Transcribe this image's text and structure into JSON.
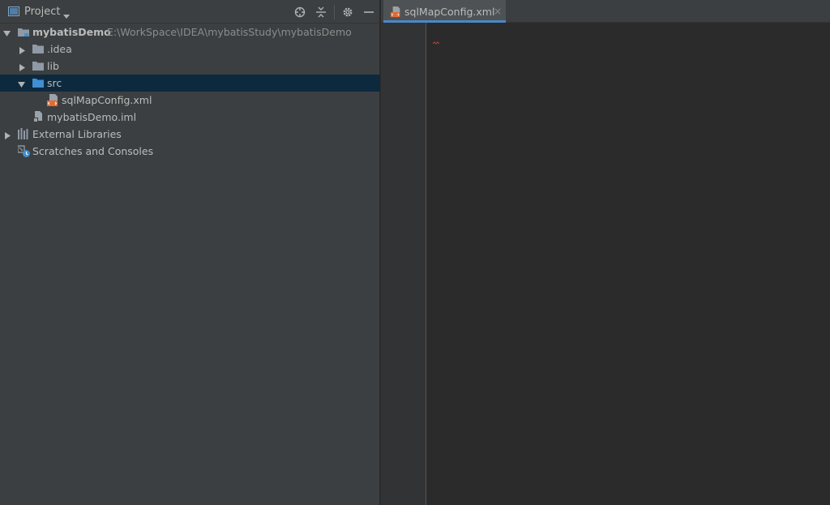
{
  "project_panel": {
    "title": "Project",
    "header_icons": [
      "locate-icon",
      "collapse-all-icon",
      "gear-icon",
      "minimize-icon"
    ]
  },
  "tree": [
    {
      "label": "mybatisDemo",
      "path": "E:\\WorkSpace\\IDEA\\mybatisStudy\\mybatisDemo",
      "expanded": true,
      "icon": "module-folder-icon"
    },
    {
      "label": ".idea",
      "expanded": false,
      "icon": "folder-icon"
    },
    {
      "label": "lib",
      "expanded": false,
      "icon": "folder-icon"
    },
    {
      "label": "src",
      "expanded": true,
      "selected": true,
      "icon": "source-folder-icon"
    },
    {
      "label": "sqlMapConfig.xml",
      "icon": "xml-file-icon"
    },
    {
      "label": "mybatisDemo.iml",
      "icon": "iml-file-icon"
    },
    {
      "label": "External Libraries",
      "expanded": false,
      "icon": "libraries-icon"
    },
    {
      "label": "Scratches and Consoles",
      "icon": "scratches-icon"
    }
  ],
  "editor": {
    "tabs": [
      {
        "label": "sqlMapConfig.xml",
        "active": true,
        "close": "×"
      }
    ]
  },
  "colors": {
    "panel_bg": "#3c3f41",
    "editor_bg": "#2b2b2b",
    "selection": "#0d293e",
    "tab_active_underline": "#4a88c7",
    "folder": "#8f9aa6",
    "source_folder": "#3f8fd2",
    "xml_icon": "#e06c35"
  }
}
